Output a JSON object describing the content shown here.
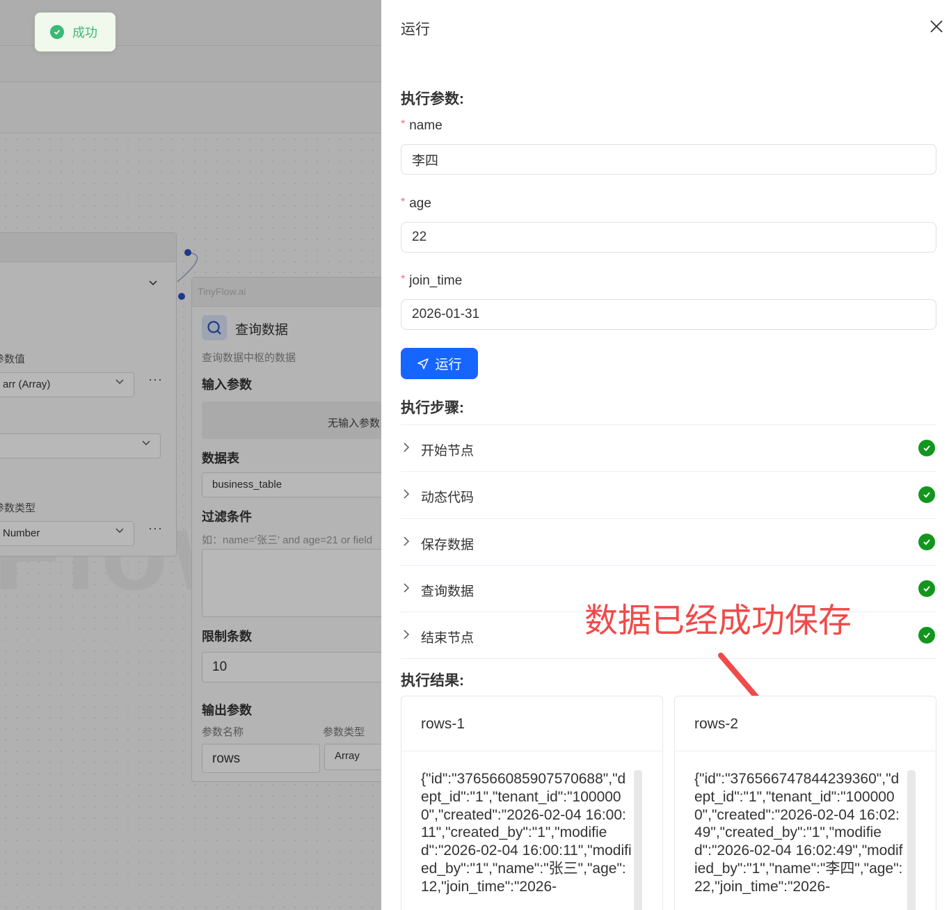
{
  "toast": {
    "message": "成功"
  },
  "background": {
    "left_node": {
      "param_value_label": "参数值",
      "param_value_select": "arr (Array)",
      "param_type_label": "参数类型",
      "param_type_select": "Number"
    },
    "right_node": {
      "brand": "TinyFlow.ai",
      "title": "查询数据",
      "description": "查询数据中枢的数据",
      "input_params_title": "输入参数",
      "no_input_params": "无输入参数",
      "table_title": "数据表",
      "table_value": "business_table",
      "filter_title": "过滤条件",
      "filter_placeholder": "如：name='张三' and age=21 or field",
      "limit_title": "限制条数",
      "limit_value": "10",
      "output_params_title": "输出参数",
      "param_name_label": "参数名称",
      "param_type_label": "参数类型",
      "output_name": "rows",
      "output_type": "Array"
    }
  },
  "drawer": {
    "title": "运行",
    "params_title": "执行参数:",
    "fields": [
      {
        "label": "name",
        "value": "李四"
      },
      {
        "label": "age",
        "value": "22"
      },
      {
        "label": "join_time",
        "value": "2026-01-31"
      }
    ],
    "run_button": "运行",
    "steps_title": "执行步骤:",
    "steps": [
      {
        "label": "开始节点",
        "status": "success"
      },
      {
        "label": "动态代码",
        "status": "success"
      },
      {
        "label": "保存数据",
        "status": "success"
      },
      {
        "label": "查询数据",
        "status": "success"
      },
      {
        "label": "结束节点",
        "status": "success"
      }
    ],
    "annotation": "数据已经成功保存",
    "result_title": "执行结果:",
    "results": [
      {
        "title": "rows-1",
        "content": "{\"id\":\"376566085907570688\",\"dept_id\":\"1\",\"tenant_id\":\"1000000\",\"created\":\"2026-02-04 16:00:11\",\"created_by\":\"1\",\"modified\":\"2026-02-04 16:00:11\",\"modified_by\":\"1\",\"name\":\"张三\",\"age\":12,\"join_time\":\"2026-"
      },
      {
        "title": "rows-2",
        "content": "{\"id\":\"376566747844239360\",\"dept_id\":\"1\",\"tenant_id\":\"1000000\",\"created\":\"2026-02-04 16:02:49\",\"created_by\":\"1\",\"modified\":\"2026-02-04 16:02:49\",\"modified_by\":\"1\",\"name\":\"李四\",\"age\":22,\"join_time\":\"2026-"
      }
    ]
  },
  "colors": {
    "primary": "#1765ff",
    "success": "#12961e",
    "annotation": "#f04a4a",
    "required": "#f56c6c",
    "toast_text": "#3cb878"
  }
}
